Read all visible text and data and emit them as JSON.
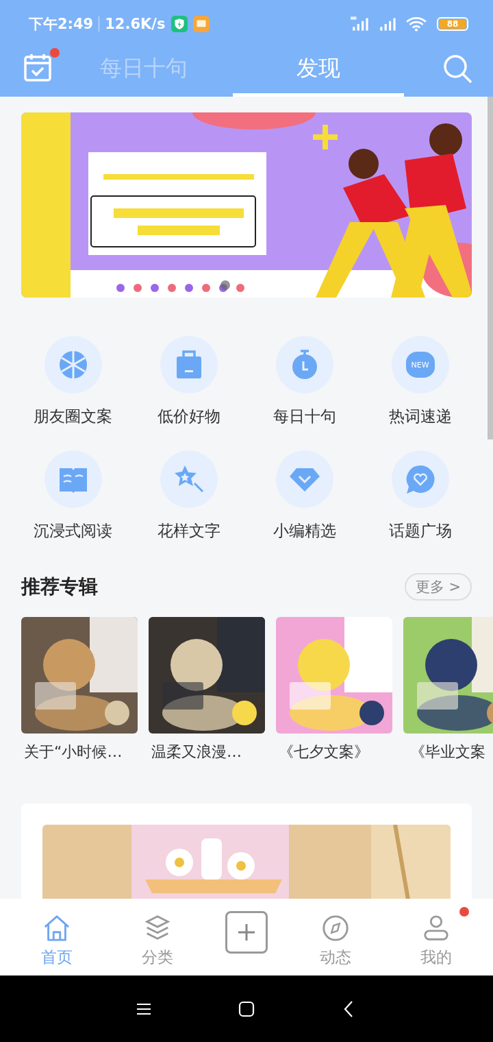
{
  "status_bar": {
    "time": "下午2:49",
    "speed": "12.6K/s",
    "battery": "88"
  },
  "header": {
    "calendar_badge": true,
    "tabs": [
      {
        "label": "每日十句",
        "selected": false
      },
      {
        "label": "发现",
        "selected": true
      }
    ]
  },
  "shortcuts": [
    {
      "label": "朋友圈文案"
    },
    {
      "label": "低价好物"
    },
    {
      "label": "每日十句"
    },
    {
      "label": "热词速递",
      "icon_text": "NEW"
    },
    {
      "label": "沉浸式阅读"
    },
    {
      "label": "花样文字"
    },
    {
      "label": "小编精选"
    },
    {
      "label": "话题广场"
    }
  ],
  "albums": {
    "title": "推荐专辑",
    "more": "更多 >",
    "items": [
      {
        "caption": "关于“小时候…"
      },
      {
        "caption": "温柔又浪漫…"
      },
      {
        "caption": "《七夕文案》"
      },
      {
        "caption": "《毕业文案"
      }
    ]
  },
  "bottom_nav": [
    {
      "kind": "tab",
      "label": "首页",
      "selected": true,
      "badge": false
    },
    {
      "kind": "tab",
      "label": "分类",
      "selected": false,
      "badge": false
    },
    {
      "kind": "add"
    },
    {
      "kind": "tab",
      "label": "动态",
      "selected": false,
      "badge": false
    },
    {
      "kind": "tab",
      "label": "我的",
      "selected": false,
      "badge": true
    }
  ]
}
